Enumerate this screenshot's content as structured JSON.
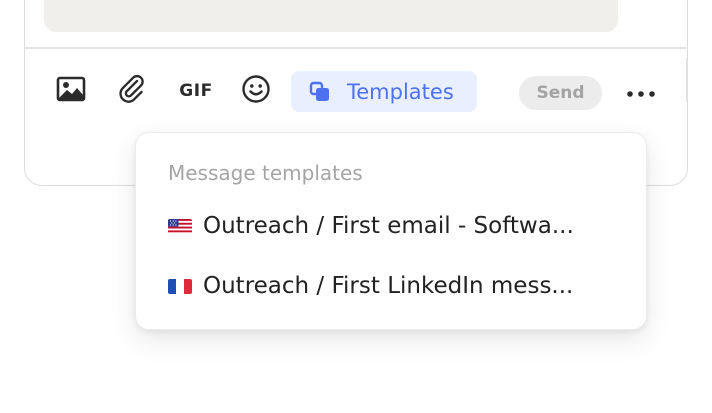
{
  "toolbar": {
    "image_icon": "image-icon",
    "attach_icon": "paperclip-icon",
    "gif_label": "GIF",
    "emoji_icon": "emoji-icon",
    "templates_label": "Templates",
    "templates_icon": "templates-icon",
    "send_label": "Send",
    "more_icon": "more-dots-icon"
  },
  "dropdown": {
    "title": "Message templates",
    "items": [
      {
        "flag": "us-flag",
        "label": "Outreach / First email - Softwa..."
      },
      {
        "flag": "fr-flag",
        "label": "Outreach / First LinkedIn mess..."
      }
    ]
  },
  "colors": {
    "accent": "#4e71ef",
    "accent_bg": "#e9efff",
    "send_disabled_bg": "#ececec",
    "send_disabled_text": "#a3a3a3",
    "text_area_bg": "#f1efeb"
  }
}
